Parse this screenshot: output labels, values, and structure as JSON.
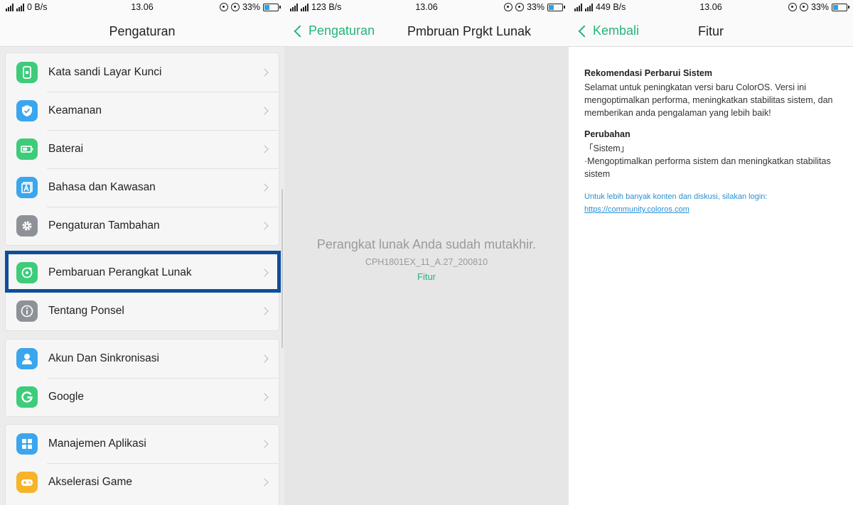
{
  "panels": [
    {
      "statusbar": {
        "speed": "0 B/s",
        "time": "13.06",
        "battery": "33%"
      },
      "title": "Pengaturan"
    },
    {
      "statusbar": {
        "speed": "123 B/s",
        "time": "13.06",
        "battery": "33%"
      },
      "back_label": "Pengaturan",
      "title": "Pmbruan Prgkt Lunak",
      "message": "Perangkat lunak Anda sudah mutakhir.",
      "version": "CPH1801EX_11_A.27_200810",
      "features_link": "Fitur"
    },
    {
      "statusbar": {
        "speed": "449 B/s",
        "time": "13.06",
        "battery": "33%"
      },
      "back_label": "Kembali",
      "title": "Fitur",
      "section1_title": "Rekomendasi Perbarui Sistem",
      "section1_body": "Selamat untuk peningkatan versi baru ColorOS. Versi ini mengoptimalkan performa, meningkatkan stabilitas sistem, dan memberikan anda pengalaman yang lebih baik!",
      "section2_title": "Perubahan",
      "section2_tag": "「Sistem」",
      "section2_body": "·Mengoptimalkan performa sistem  dan meningkatkan stabilitas sistem",
      "community_note": "Untuk lebih banyak konten dan diskusi, silakan login:",
      "community_url": "https://community.coloros.com"
    }
  ],
  "settings_groups": [
    {
      "items": [
        {
          "label": "Kata sandi Layar Kunci",
          "icon": "lock-screen-icon",
          "color": "#3dcc7a"
        },
        {
          "label": "Keamanan",
          "icon": "shield-icon",
          "color": "#3aa6ee"
        },
        {
          "label": "Baterai",
          "icon": "battery-icon",
          "color": "#3dcc7a"
        },
        {
          "label": "Bahasa dan Kawasan",
          "icon": "language-icon",
          "color": "#3aa6ee"
        },
        {
          "label": "Pengaturan Tambahan",
          "icon": "gear-icon",
          "color": "#8e9298"
        }
      ]
    },
    {
      "items": [
        {
          "label": "Pembaruan Perangkat Lunak",
          "icon": "update-icon",
          "color": "#3dcc7a"
        },
        {
          "label": "Tentang Ponsel",
          "icon": "info-icon",
          "color": "#8e9298"
        }
      ]
    },
    {
      "items": [
        {
          "label": "Akun Dan Sinkronisasi",
          "icon": "account-icon",
          "color": "#3aa6ee"
        },
        {
          "label": "Google",
          "icon": "google-icon",
          "color": "#3dcc7a"
        }
      ]
    },
    {
      "items": [
        {
          "label": "Manajemen Aplikasi",
          "icon": "apps-icon",
          "color": "#3aa6ee"
        },
        {
          "label": "Akselerasi Game",
          "icon": "gamepad-icon",
          "color": "#f6b42a"
        }
      ]
    }
  ],
  "colors": {
    "accent": "#26b37a",
    "highlight": "#0e4e9a",
    "link": "#2a8fd3"
  }
}
